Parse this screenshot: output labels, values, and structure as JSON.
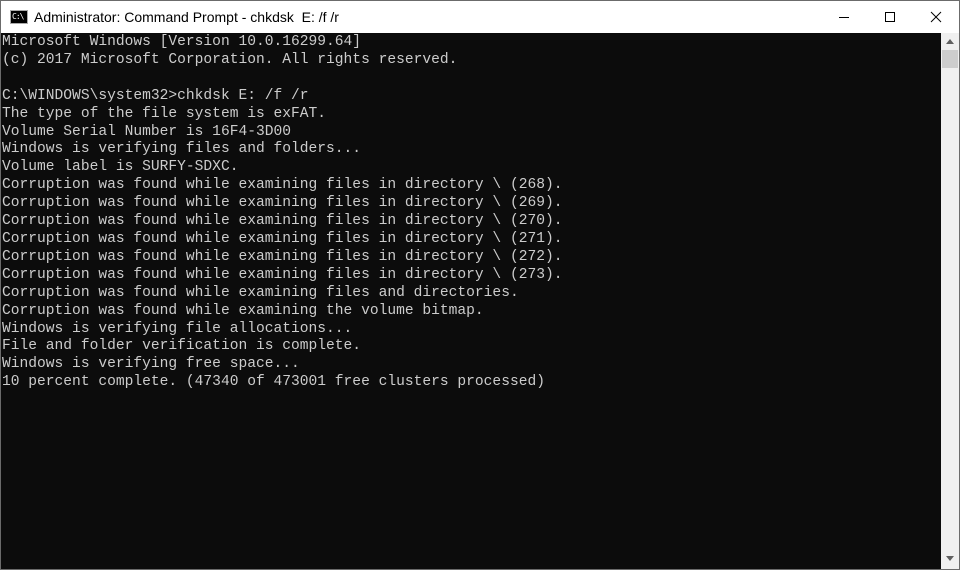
{
  "window": {
    "title": "Administrator: Command Prompt - chkdsk  E: /f /r",
    "icon_name": "cmd-icon",
    "icon_glyph": "C:\\"
  },
  "console": {
    "lines": [
      "Microsoft Windows [Version 10.0.16299.64]",
      "(c) 2017 Microsoft Corporation. All rights reserved.",
      "",
      "C:\\WINDOWS\\system32>chkdsk E: /f /r",
      "The type of the file system is exFAT.",
      "Volume Serial Number is 16F4-3D00",
      "Windows is verifying files and folders...",
      "Volume label is SURFY-SDXC.",
      "Corruption was found while examining files in directory \\ (268).",
      "Corruption was found while examining files in directory \\ (269).",
      "Corruption was found while examining files in directory \\ (270).",
      "Corruption was found while examining files in directory \\ (271).",
      "Corruption was found while examining files in directory \\ (272).",
      "Corruption was found while examining files in directory \\ (273).",
      "Corruption was found while examining files and directories.",
      "Corruption was found while examining the volume bitmap.",
      "Windows is verifying file allocations...",
      "File and folder verification is complete.",
      "Windows is verifying free space...",
      "10 percent complete. (47340 of 473001 free clusters processed)"
    ]
  },
  "colors": {
    "console_background": "#0c0c0c",
    "console_text": "#cccccc",
    "titlebar_background": "#ffffff"
  }
}
